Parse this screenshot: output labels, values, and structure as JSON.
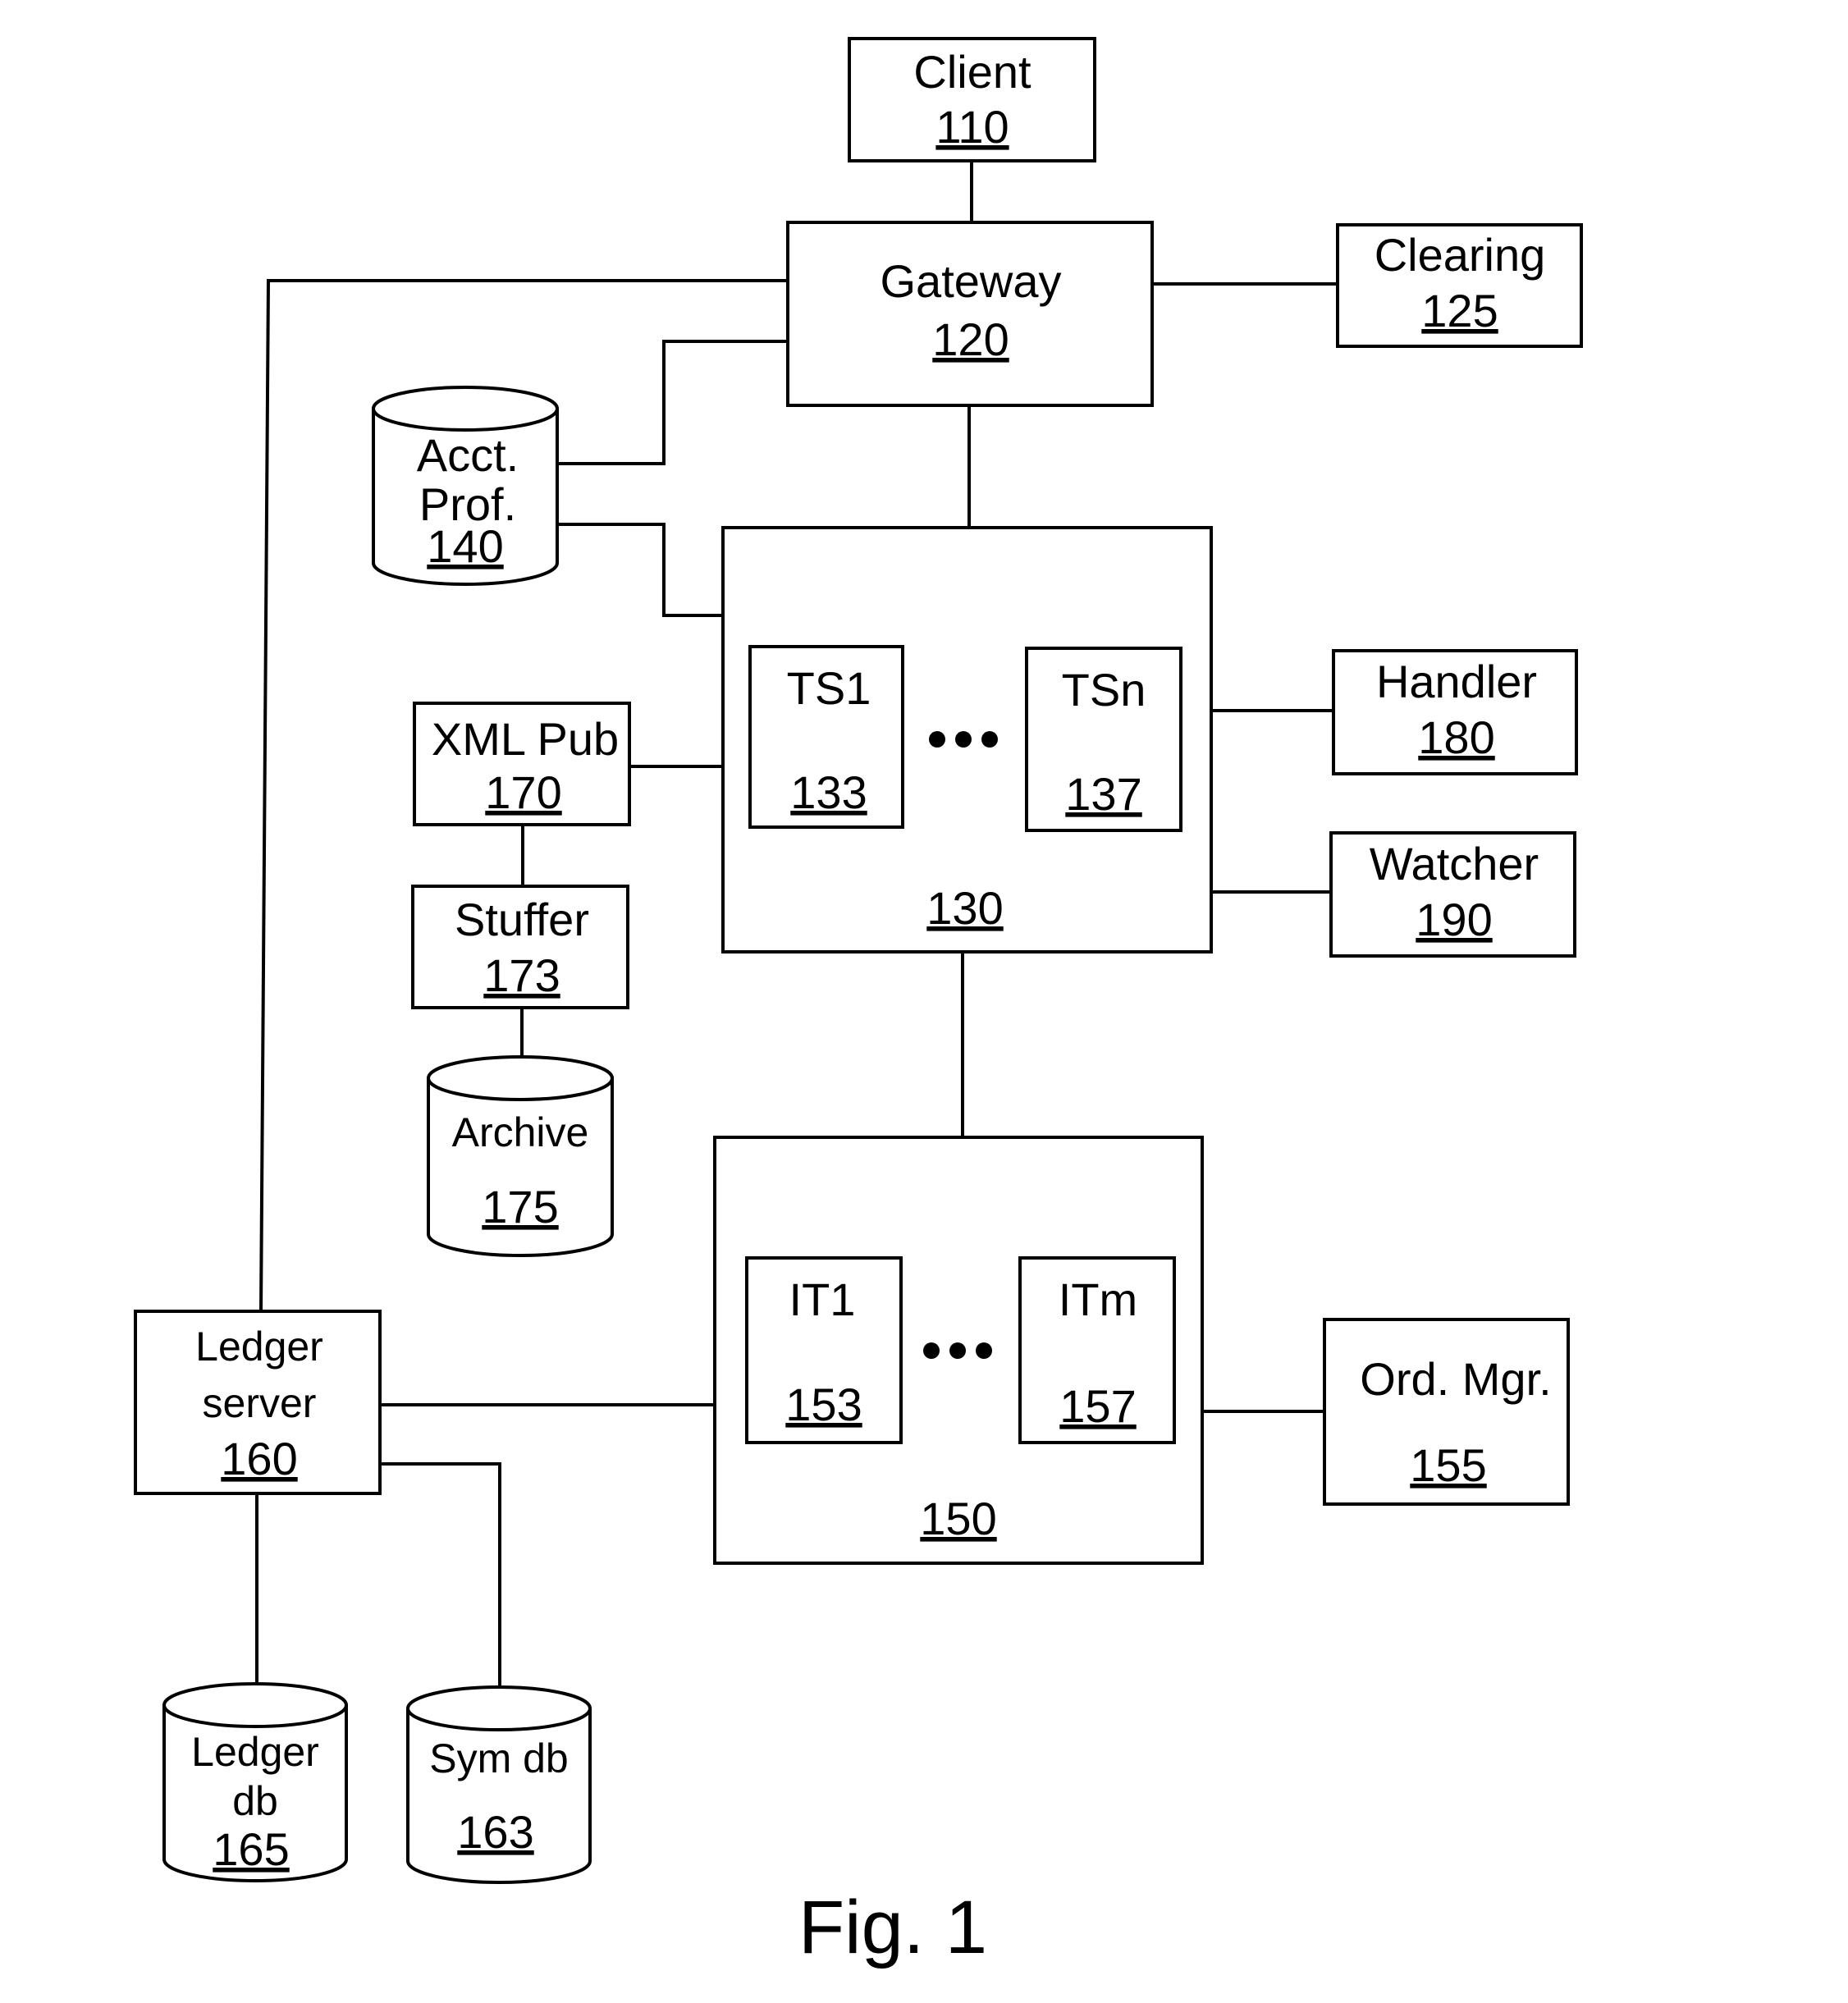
{
  "figure": {
    "caption": "Fig. 1",
    "nodes": {
      "client": {
        "label": "Client",
        "ref": "110"
      },
      "gateway": {
        "label": "Gateway",
        "ref": "120"
      },
      "clearing": {
        "label": "Clearing",
        "ref": "125"
      },
      "acct_prof": {
        "label_line1": "Acct.",
        "label_line2": "Prof.",
        "ref": "140"
      },
      "trading_cluster": {
        "ref": "130"
      },
      "ts1": {
        "label": "TS1",
        "ref": "133"
      },
      "tsn": {
        "label": "TSn",
        "ref": "137"
      },
      "xml_pub": {
        "label": "XML Pub",
        "ref": "170"
      },
      "stuffer": {
        "label": "Stuffer",
        "ref": "173"
      },
      "archive": {
        "label": "Archive",
        "ref": "175"
      },
      "handler": {
        "label": "Handler",
        "ref": "180"
      },
      "watcher": {
        "label": "Watcher",
        "ref": "190"
      },
      "internal_cluster": {
        "ref": "150"
      },
      "it1": {
        "label": "IT1",
        "ref": "153"
      },
      "itm": {
        "label": "ITm",
        "ref": "157"
      },
      "ord_mgr": {
        "label": "Ord. Mgr.",
        "ref": "155"
      },
      "ledger_server": {
        "label_line1": "Ledger",
        "label_line2": "server",
        "ref": "160"
      },
      "ledger_db": {
        "label_line1": "Ledger",
        "label_line2": "db",
        "ref": "165"
      },
      "sym_db": {
        "label": "Sym db",
        "ref": "163"
      }
    },
    "ellipsis": "•••",
    "connections": [
      [
        "client",
        "gateway"
      ],
      [
        "gateway",
        "clearing"
      ],
      [
        "gateway",
        "trading_cluster"
      ],
      [
        "gateway",
        "acct_prof"
      ],
      [
        "gateway",
        "ledger_server"
      ],
      [
        "acct_prof",
        "trading_cluster"
      ],
      [
        "xml_pub",
        "trading_cluster"
      ],
      [
        "xml_pub",
        "stuffer"
      ],
      [
        "stuffer",
        "archive"
      ],
      [
        "trading_cluster",
        "handler"
      ],
      [
        "trading_cluster",
        "watcher"
      ],
      [
        "trading_cluster",
        "internal_cluster"
      ],
      [
        "internal_cluster",
        "ord_mgr"
      ],
      [
        "ledger_server",
        "internal_cluster"
      ],
      [
        "ledger_server",
        "ledger_db"
      ],
      [
        "ledger_server",
        "sym_db"
      ]
    ]
  }
}
